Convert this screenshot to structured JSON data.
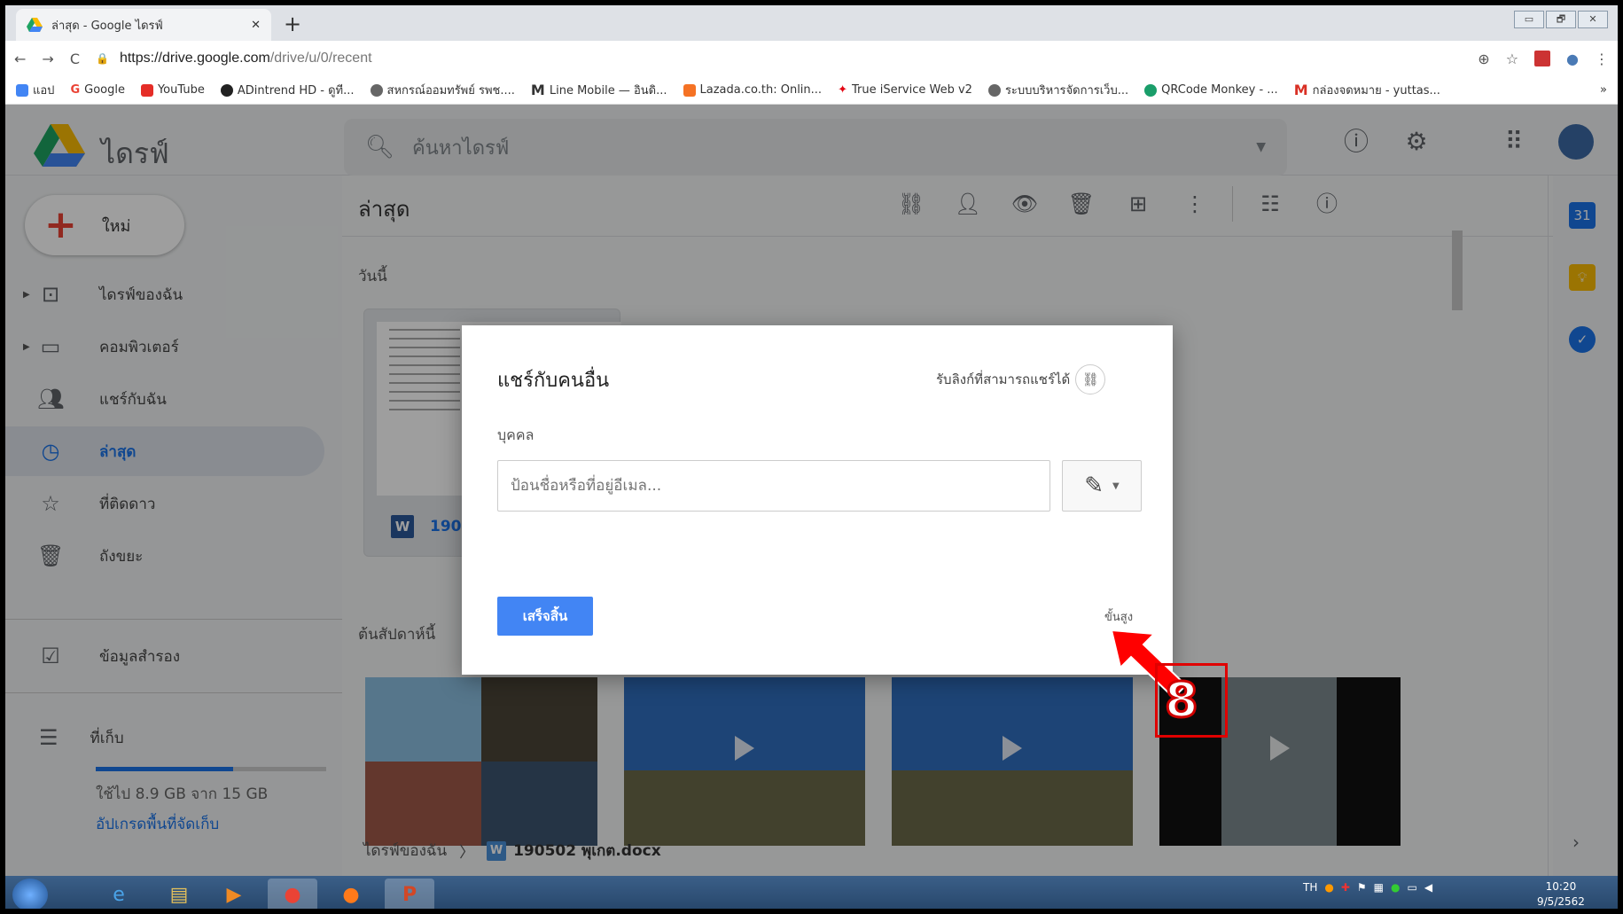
{
  "browser": {
    "tab_title": "ล่าสุด - Google ไดรฟ์",
    "url_domain": "https://drive.google.com",
    "url_path": "/drive/u/0/recent",
    "window_controls": [
      "▭",
      "🗗",
      "✕"
    ],
    "bookmarks": [
      {
        "label": "แอป",
        "color": "#1a73e8"
      },
      {
        "label": "Google",
        "color": "#ea4335"
      },
      {
        "label": "YouTube",
        "color": "#e52d27"
      },
      {
        "label": "ADintrend HD - ดูที...",
        "color": "#222222"
      },
      {
        "label": "สหกรณ์ออมทรัพย์ รพช....",
        "color": "#555555"
      },
      {
        "label": "Line Mobile — อินดิ...",
        "color": "#222222"
      },
      {
        "label": "Lazada.co.th: Onlin...",
        "color": "#f57224"
      },
      {
        "label": "True iService Web v2",
        "color": "#e30613"
      },
      {
        "label": "ระบบบริหารจัดการเว็บ...",
        "color": "#555555"
      },
      {
        "label": "QRCode Monkey - ...",
        "color": "#1a9e6a"
      },
      {
        "label": "กล่องจดหมาย - yuttas...",
        "color": "#d93025"
      }
    ]
  },
  "drive": {
    "app_name": "ไดรฟ์",
    "search_placeholder": "ค้นหาไดรฟ์",
    "new_label": "ใหม่",
    "nav": [
      {
        "label": "ไดรฟ์ของฉัน",
        "icon": "drive-icon"
      },
      {
        "label": "คอมพิวเตอร์",
        "icon": "computer-icon"
      },
      {
        "label": "แชร์กับฉัน",
        "icon": "people-icon"
      },
      {
        "label": "ล่าสุด",
        "icon": "clock-icon"
      },
      {
        "label": "ที่ติดดาว",
        "icon": "star-icon"
      },
      {
        "label": "ถังขยะ",
        "icon": "trash-icon"
      },
      {
        "label": "ข้อมูลสำรอง",
        "icon": "backup-icon"
      }
    ],
    "storage": {
      "label": "ที่เก็บ",
      "used_text": "ใช้ไป 8.9 GB จาก 15 GB",
      "used_fraction": 0.59,
      "upgrade": "อัปเกรดพื้นที่จัดเก็บ"
    },
    "main_title": "ล่าสุด",
    "section_today": "วันนี้",
    "section_earlier": "ต้นสัปดาห์นี้",
    "card_file_short": "190",
    "breadcrumb_root": "ไดรฟ์ของฉัน",
    "breadcrumb_file": "190502 พุเกต.docx",
    "accent_color": "#1a73e8"
  },
  "dialog": {
    "title": "แชร์กับคนอื่น",
    "get_link": "รับลิงก์ที่สามารถแชร์ได้",
    "people_label": "บุคคล",
    "input_placeholder": "ป้อนชื่อหรือที่อยู่อีเมล...",
    "done_button": "เสร็จสิ้น",
    "advanced": "ขั้นสูง"
  },
  "annotation": {
    "step_number": "8"
  },
  "taskbar": {
    "language": "TH",
    "time": "10:20",
    "date": "9/5/2562"
  }
}
